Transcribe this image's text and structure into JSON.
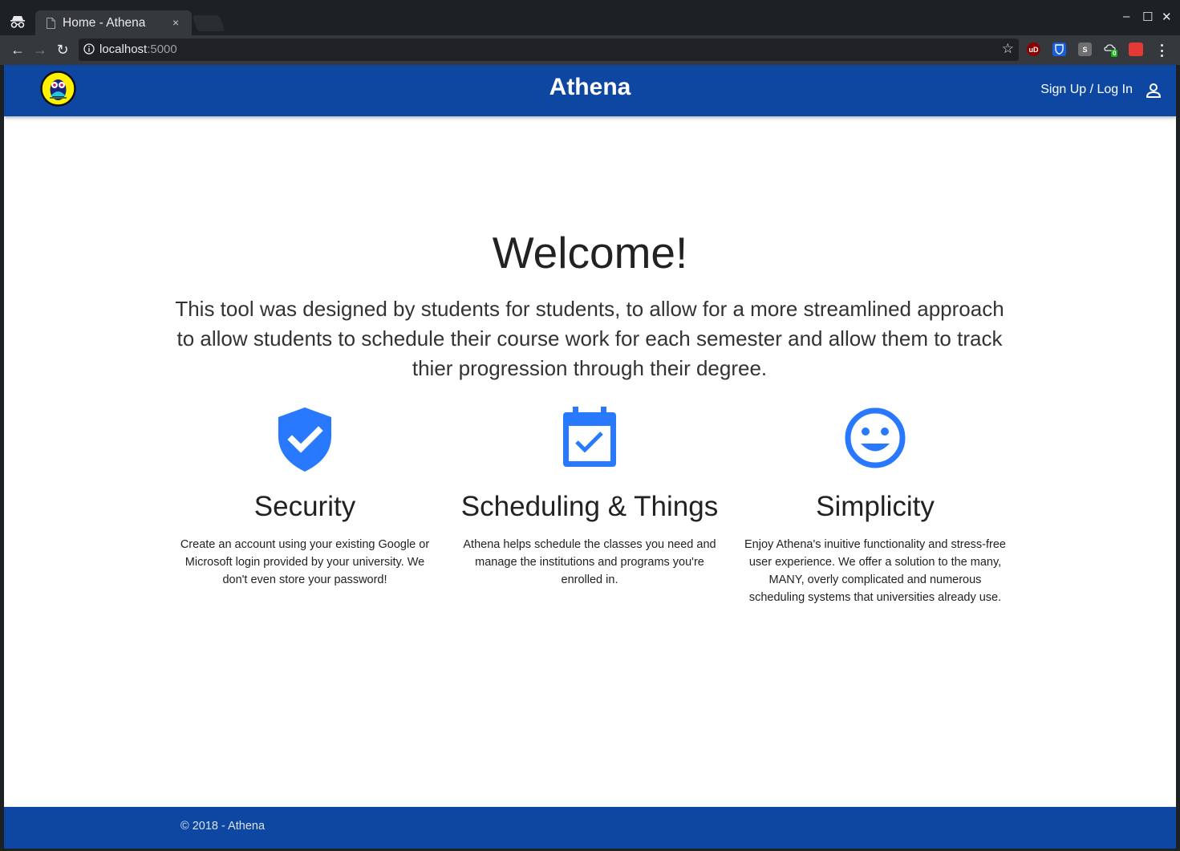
{
  "browser": {
    "tab": {
      "title": "Home - Athena",
      "close_glyph": "×"
    },
    "window_controls": {
      "minimize": "‒",
      "maximize": "☐",
      "close": "✕"
    },
    "nav": {
      "back": "←",
      "forward": "→",
      "reload": "↻"
    },
    "address": {
      "host": "localhost",
      "port": ":5000"
    },
    "bookmark_glyph": "☆",
    "extensions": [
      {
        "name": "ublock-origin",
        "label": "uD",
        "color": "#8b0000"
      },
      {
        "name": "bitwarden",
        "label": "",
        "color": "#175ddc"
      },
      {
        "name": "extension-s",
        "label": "S",
        "color": "#6f6f6f"
      },
      {
        "name": "extension-counter",
        "label": "0",
        "color": "#3a3a3a"
      },
      {
        "name": "extension-red",
        "label": "",
        "color": "#e53935"
      }
    ]
  },
  "app": {
    "brand": "Athena",
    "nav": {
      "signup_login": "Sign Up / Log In"
    },
    "welcome": "Welcome!",
    "intro": "This tool was designed by students for students, to allow for a more streamlined approach to allow students to schedule their course work for each semester and allow them to track thier progression through their degree.",
    "features": [
      {
        "icon": "shield-check-icon",
        "title": "Security",
        "text": "Create an account using your existing Google or Microsoft login provided by your university. We don't even store your password!"
      },
      {
        "icon": "calendar-check-icon",
        "title": "Scheduling & Things",
        "text": "Athena helps schedule the classes you need and manage the institutions and programs you're enrolled in."
      },
      {
        "icon": "smiley-icon",
        "title": "Simplicity",
        "text": "Enjoy Athena's inuitive functionality and stress-free user experience. We offer a solution to the many, MANY, overly complicated and numerous scheduling systems that universities already use."
      }
    ],
    "footer": "© 2018 - Athena"
  },
  "colors": {
    "primary": "#0d47a1",
    "icon_blue": "#2979ff",
    "chrome_dark": "#1e2124",
    "chrome_toolbar": "#35393d"
  }
}
